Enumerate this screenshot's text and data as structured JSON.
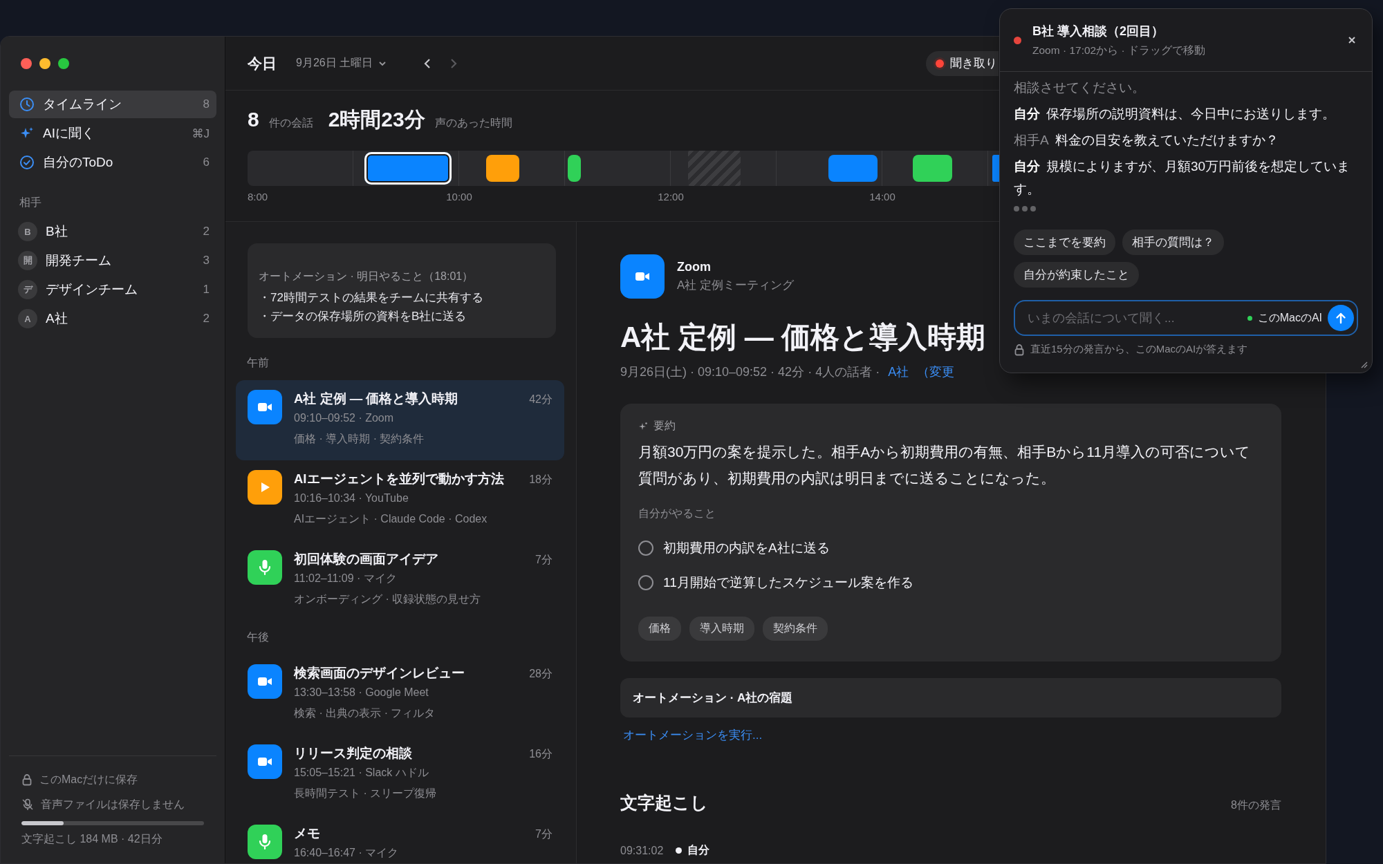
{
  "sidebar": {
    "nav": [
      {
        "kind": "timeline",
        "label": "タイムライン",
        "badge": "8",
        "selected": true
      },
      {
        "kind": "ask",
        "label": "AIに聞く",
        "badge": "⌘J",
        "selected": false
      },
      {
        "kind": "todo",
        "label": "自分のToDo",
        "badge": "6",
        "selected": false
      }
    ],
    "contacts_heading": "相手",
    "contacts": [
      {
        "initial": "B",
        "name": "B社",
        "count": "2"
      },
      {
        "initial": "開",
        "name": "開発チーム",
        "count": "3"
      },
      {
        "initial": "デ",
        "name": "デザインチーム",
        "count": "1"
      },
      {
        "initial": "A",
        "name": "A社",
        "count": "2"
      }
    ],
    "footer": {
      "local_note": "このMacだけに保存",
      "audio_note": "音声ファイルは保存しません",
      "storage": {
        "level": 0.23
      },
      "usage": "文字起こし 184 MB · 42日分"
    }
  },
  "header": {
    "title": "今日",
    "date": "9月26日 土曜日",
    "recording": {
      "active": true,
      "label": "聞き取り"
    }
  },
  "day_summary": {
    "count": "8",
    "count_label": "件の会話",
    "duration": "2時間23分",
    "duration_label": "声のあった時間"
  },
  "timeline": {
    "ticks": [
      "8:00",
      "10:00",
      "12:00",
      "14:00"
    ],
    "segments": [
      {
        "kind": "conversation",
        "color": "#0a84ff",
        "selected": true
      },
      {
        "kind": "conversation",
        "color": "#ff9f0a",
        "selected": false
      },
      {
        "kind": "conversation",
        "color": "#30d158",
        "selected": false
      },
      {
        "kind": "silence"
      },
      {
        "kind": "conversation",
        "color": "#0a84ff",
        "selected": false
      },
      {
        "kind": "conversation",
        "color": "#30d158",
        "selected": false
      },
      {
        "kind": "conversation",
        "color": "#0a84ff",
        "selected": false
      }
    ]
  },
  "automation_card": {
    "title": "オートメーション · 明日やること（18:01）",
    "items": [
      "・72時間テストの結果をチームに共有する",
      "・データの保存場所の資料をB社に送る"
    ]
  },
  "sections": [
    {
      "heading": "午前",
      "conversations": [
        {
          "kind": "video",
          "title": "A社 定例 — 価格と導入時期",
          "duration": "42分",
          "time": "09:10–09:52 · Zoom",
          "tags": "価格 · 導入時期 · 契約条件",
          "selected": true
        },
        {
          "kind": "play",
          "title": "AIエージェントを並列で動かす方法",
          "duration": "18分",
          "time": "10:16–10:34 · YouTube",
          "tags": "AIエージェント · Claude Code · Codex",
          "selected": false
        },
        {
          "kind": "mic",
          "title": "初回体験の画面アイデア",
          "duration": "7分",
          "time": "11:02–11:09 · マイク",
          "tags": "オンボーディング · 収録状態の見せ方",
          "selected": false
        }
      ]
    },
    {
      "heading": "午後",
      "conversations": [
        {
          "kind": "video",
          "title": "検索画面のデザインレビュー",
          "duration": "28分",
          "time": "13:30–13:58 · Google Meet",
          "tags": "検索 · 出典の表示 · フィルタ",
          "selected": false
        },
        {
          "kind": "video",
          "title": "リリース判定の相談",
          "duration": "16分",
          "time": "15:05–15:21 · Slack ハドル",
          "tags": "長時間テスト · スリープ復帰",
          "selected": false
        },
        {
          "kind": "mic",
          "title": "メモ",
          "duration": "7分",
          "time": "16:40–16:47 · マイク",
          "selected": false
        }
      ]
    }
  ],
  "detail": {
    "source": {
      "kind": "video",
      "name": "Zoom",
      "subtitle": "A社 定例ミーティング"
    },
    "title": "A社 定例 — 価格と導入時期",
    "meta": "9月26日(土) · 09:10–09:52 · 42分 · 4人の話者 ·",
    "contact_link": "A社",
    "change_link": "（変更",
    "summary": {
      "heading": "要約",
      "text": "月額30万円の案を提示した。相手Aから初期費用の有無、相手Bから11月導入の可否について質問があり、初期費用の内訳は明日までに送ることになった。",
      "todo_heading": "自分がやること",
      "todos": [
        {
          "text": "初期費用の内訳をA社に送る",
          "checked": false
        },
        {
          "text": "11月開始で逆算したスケジュール案を作る",
          "checked": false
        }
      ],
      "tags": [
        "価格",
        "導入時期",
        "契約条件"
      ]
    },
    "automation": {
      "title": "オートメーション · A社の宿題",
      "run_link": "オートメーションを実行..."
    },
    "transcript": {
      "heading": "文字起こし",
      "count": "8件の発言",
      "entries": [
        {
          "time": "09:31:02",
          "speaker": "自分"
        }
      ]
    }
  },
  "live_panel": {
    "recording": true,
    "title": "B社 導入相談（2回目）",
    "subtitle": "Zoom · 17:02から · ドラッグで移動",
    "lines": [
      {
        "kind": "fragment",
        "text": "相談させてください。"
      },
      {
        "kind": "self",
        "speaker": "自分",
        "text": "保存場所の説明資料は、今日中にお送りします。"
      },
      {
        "kind": "other",
        "speaker": "相手A",
        "text": "料金の目安を教えていただけますか？"
      },
      {
        "kind": "self",
        "speaker": "自分",
        "text": "規模によりますが、月額30万円前後を想定しています。"
      }
    ],
    "typing": true,
    "suggestions": [
      "ここまでを要約",
      "相手の質問は？",
      "自分が約束したこと"
    ],
    "input": {
      "placeholder": "いまの会話について聞く...",
      "model_label": "このMacのAI"
    },
    "footnote": "直近15分の発言から、このMacのAIが答えます"
  }
}
